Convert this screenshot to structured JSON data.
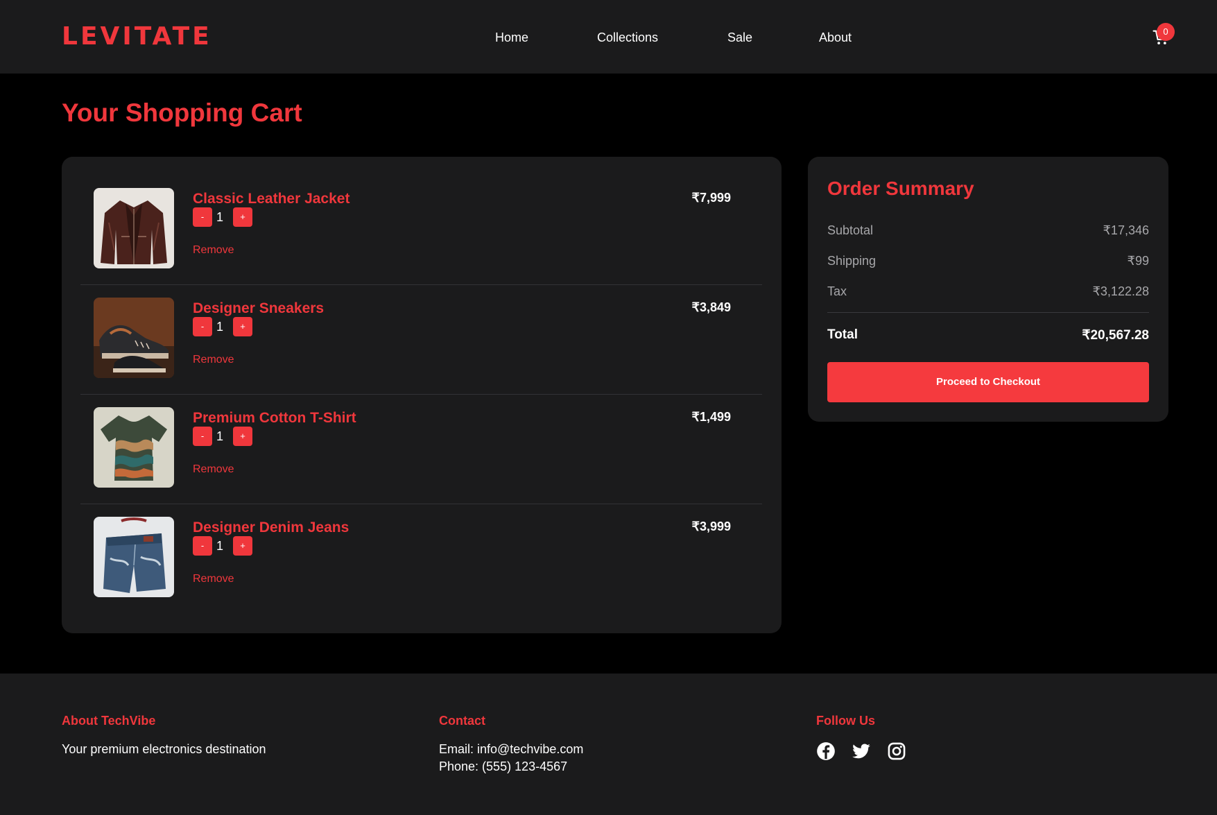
{
  "header": {
    "logo": "LEVITATE",
    "nav": [
      "Home",
      "Collections",
      "Sale",
      "About"
    ],
    "cart_count": "0"
  },
  "page": {
    "title": "Your Shopping Cart"
  },
  "cart": {
    "items": [
      {
        "name": "Classic Leather Jacket",
        "price": "₹7,999",
        "qty": "1",
        "minus": "-",
        "plus": "+",
        "remove": "Remove",
        "image": "leather-jacket-photo"
      },
      {
        "name": "Designer Sneakers",
        "price": "₹3,849",
        "qty": "1",
        "minus": "-",
        "plus": "+",
        "remove": "Remove",
        "image": "sneakers-photo"
      },
      {
        "name": "Premium Cotton T-Shirt",
        "price": "₹1,499",
        "qty": "1",
        "minus": "-",
        "plus": "+",
        "remove": "Remove",
        "image": "tshirt-photo"
      },
      {
        "name": "Designer Denim Jeans",
        "price": "₹3,999",
        "qty": "1",
        "minus": "-",
        "plus": "+",
        "remove": "Remove",
        "image": "jeans-photo"
      }
    ]
  },
  "summary": {
    "title": "Order Summary",
    "subtotal_label": "Subtotal",
    "subtotal_value": "₹17,346",
    "shipping_label": "Shipping",
    "shipping_value": "₹99",
    "tax_label": "Tax",
    "tax_value": "₹3,122.28",
    "total_label": "Total",
    "total_value": "₹20,567.28",
    "checkout_label": "Proceed to Checkout"
  },
  "footer": {
    "about_heading": "About TechVibe",
    "about_text": "Your premium electronics destination",
    "contact_heading": "Contact",
    "email": "Email: info@techvibe.com",
    "phone": "Phone: (555) 123-4567",
    "follow_heading": "Follow Us",
    "social_icons": [
      "facebook-icon",
      "twitter-icon",
      "instagram-icon"
    ]
  },
  "colors": {
    "accent": "#f0373c",
    "panel": "#1b1b1c",
    "background": "#000000"
  }
}
